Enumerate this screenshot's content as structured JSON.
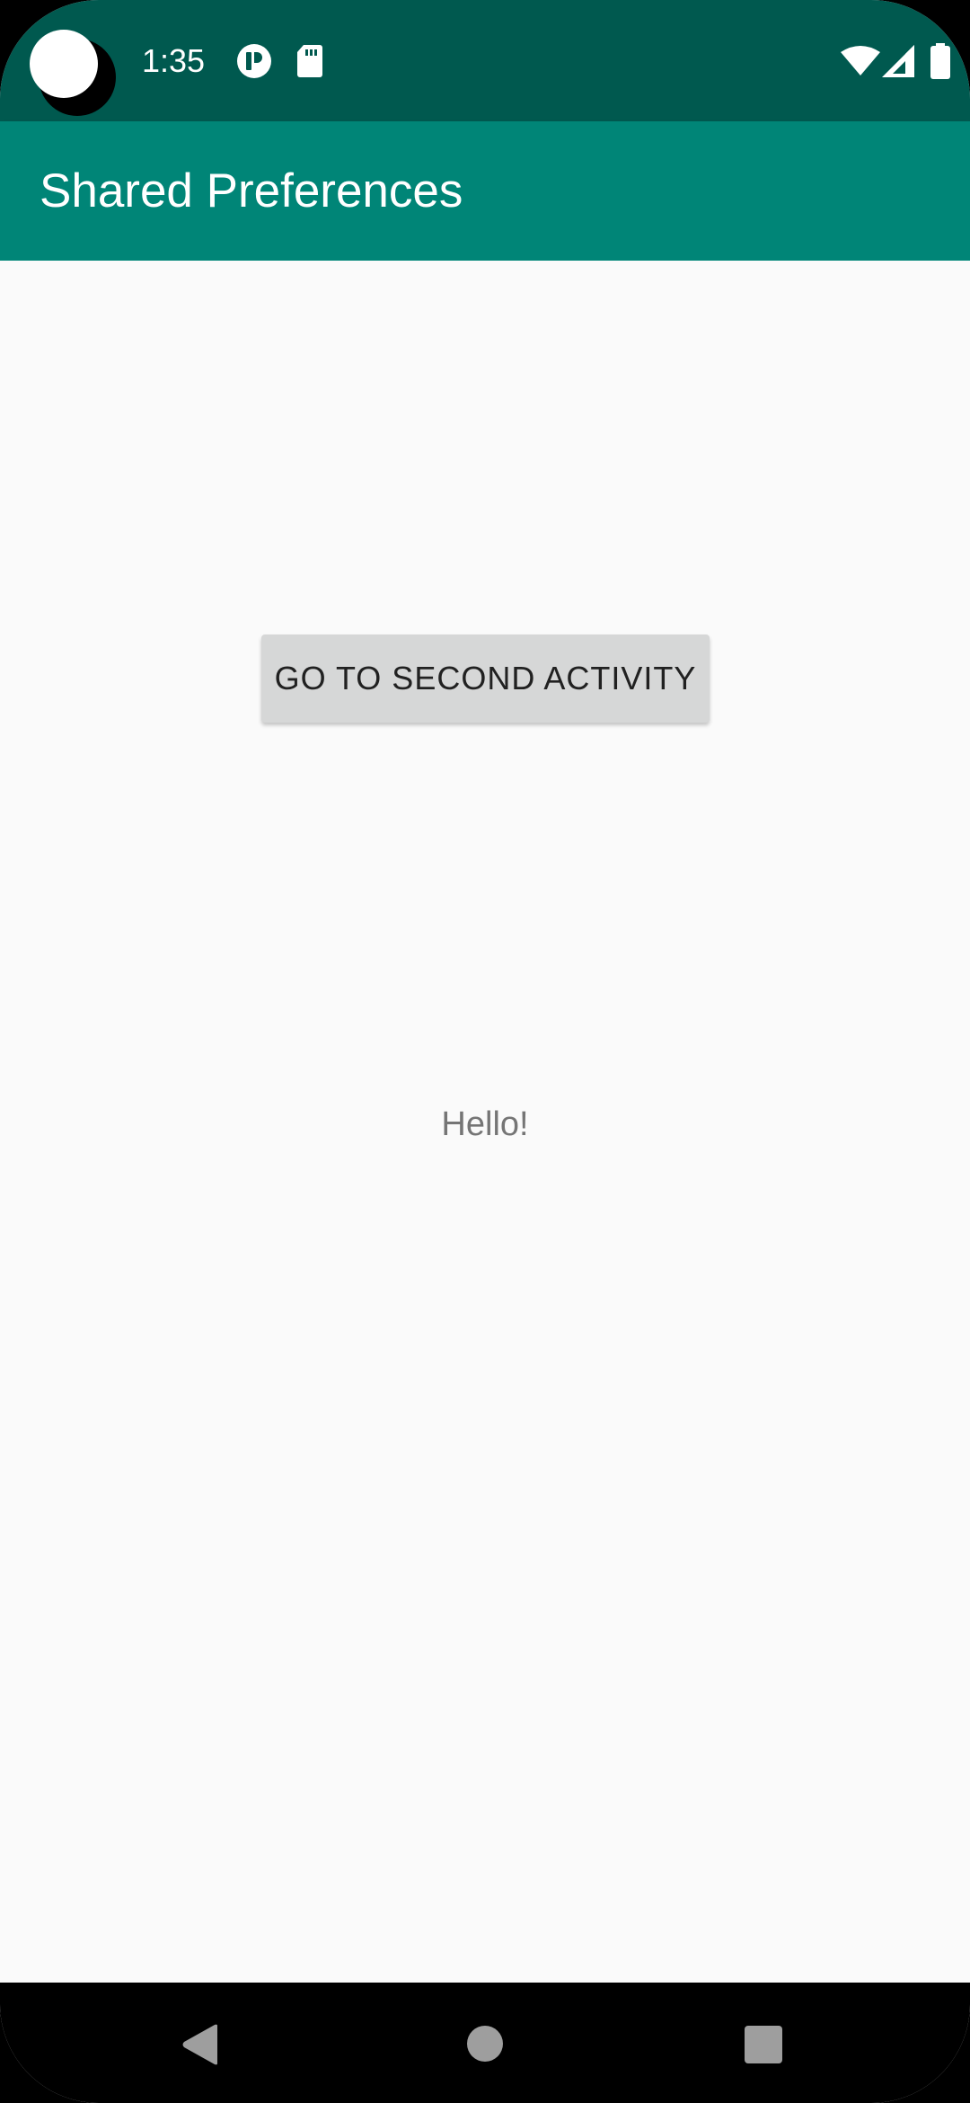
{
  "status_bar": {
    "time": "1:35",
    "icons": [
      "notification-app-icon",
      "sd-card-icon",
      "wifi-icon",
      "cellular-signal-icon",
      "battery-icon"
    ]
  },
  "app_bar": {
    "title": "Shared Preferences"
  },
  "main": {
    "button_label": "GO TO SECOND ACTIVITY",
    "message": "Hello!"
  },
  "nav_bar": {
    "icons": [
      "back-icon",
      "home-icon",
      "recents-icon"
    ]
  },
  "colors": {
    "status_bar": "#00594f",
    "app_bar": "#008577",
    "background": "#fafafa",
    "button": "#d6d7d7"
  }
}
